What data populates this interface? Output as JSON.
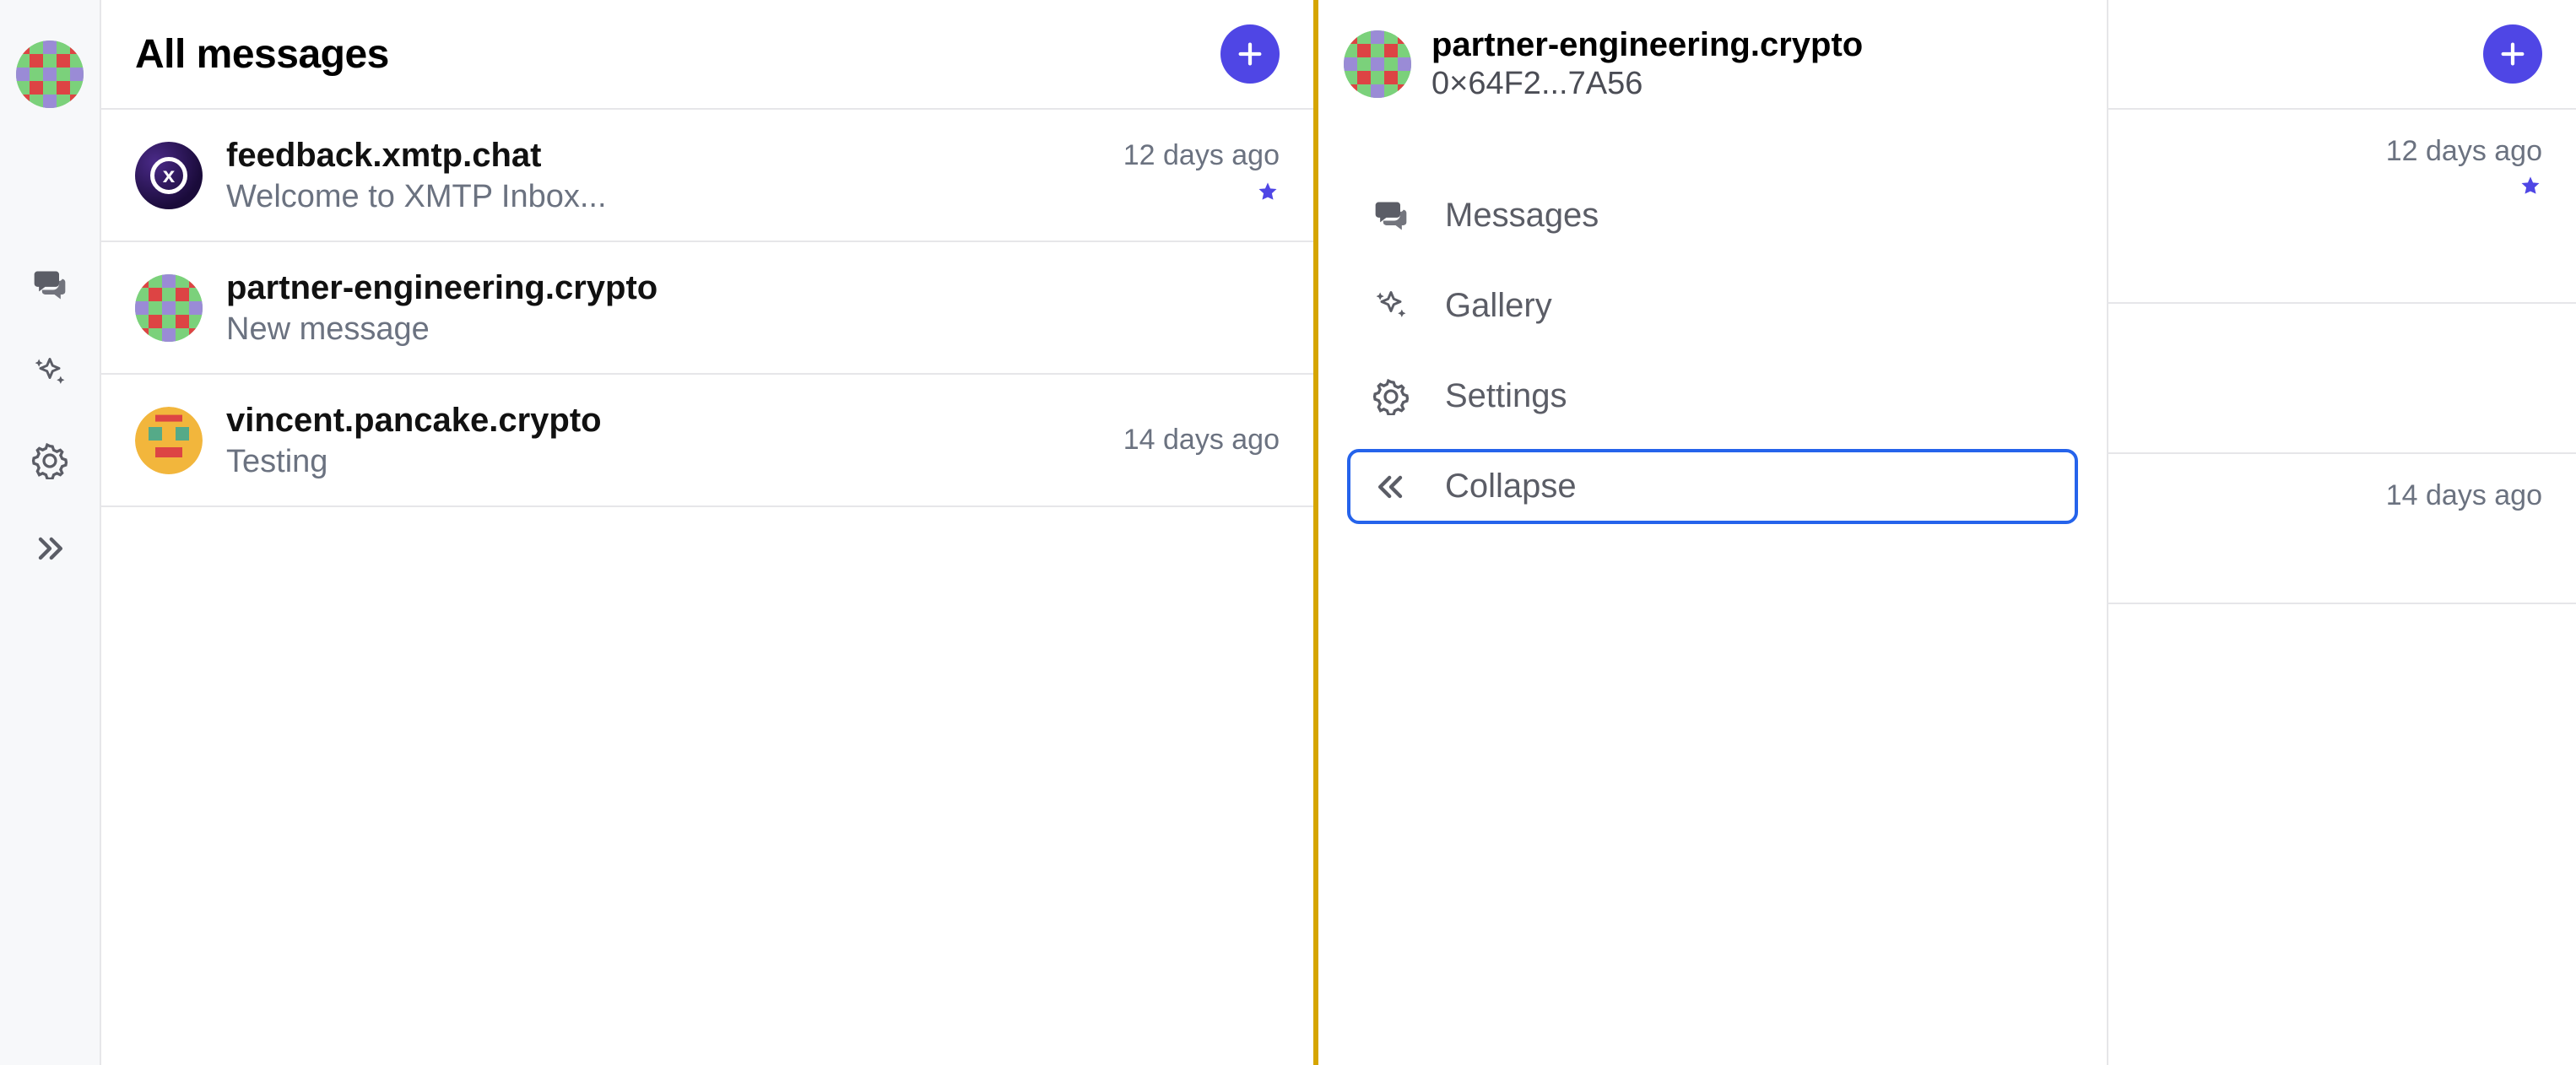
{
  "panel_a": {
    "header_title": "All messages",
    "conversations": [
      {
        "name": "feedback.xmtp.chat",
        "preview": "Welcome to XMTP Inbox...",
        "time": "12 days ago",
        "starred": true
      },
      {
        "name": "partner-engineering.crypto",
        "preview": "New message",
        "time": "",
        "starred": false
      },
      {
        "name": "vincent.pancake.crypto",
        "preview": "Testing",
        "time": "14 days ago",
        "starred": false
      }
    ]
  },
  "panel_b": {
    "identity": {
      "name": "partner-engineering.crypto",
      "address": "0×64F2...7A56"
    },
    "nav": {
      "messages": "Messages",
      "gallery": "Gallery",
      "settings": "Settings",
      "collapse": "Collapse"
    },
    "conversations": [
      {
        "time": "12 days ago",
        "starred": true
      },
      {
        "time": "",
        "starred": false
      },
      {
        "time": "14 days ago",
        "starred": false
      }
    ]
  }
}
